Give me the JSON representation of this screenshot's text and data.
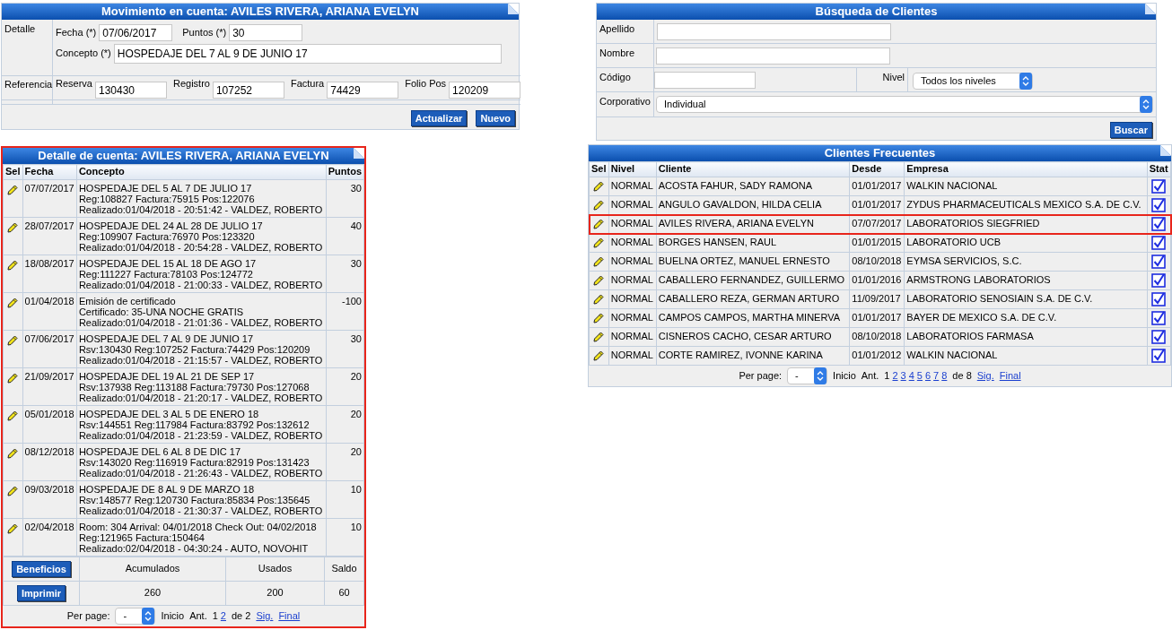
{
  "movimiento": {
    "title": "Movimiento en cuenta: AVILES RIVERA, ARIANA EVELYN",
    "detalle_label": "Detalle",
    "fecha": {
      "label": "Fecha (*)",
      "value": "07/06/2017"
    },
    "puntos": {
      "label": "Puntos (*)",
      "value": "30"
    },
    "concepto": {
      "label": "Concepto (*)",
      "value": "HOSPEDAJE DEL 7 AL 9 DE JUNIO 17"
    },
    "referencia_label": "Referencia",
    "referencias": [
      {
        "label": "Reserva",
        "value": "130430"
      },
      {
        "label": "Registro",
        "value": "107252"
      },
      {
        "label": "Factura",
        "value": "74429"
      },
      {
        "label": "Folio Pos",
        "value": "120209"
      }
    ],
    "buttons": [
      "Actualizar",
      "Nuevo"
    ]
  },
  "detalle": {
    "title": "Detalle de cuenta: AVILES RIVERA, ARIANA EVELYN",
    "highlighted": true,
    "columns": [
      "Sel",
      "Fecha",
      "Concepto",
      "Puntos"
    ],
    "rows": [
      {
        "fecha": "07/07/2017",
        "lines": [
          "HOSPEDAJE DEL 5 AL 7 DE JULIO 17",
          "Reg:108827 Factura:75915 Pos:122076",
          "Realizado:01/04/2018 - 20:51:42 - VALDEZ, ROBERTO"
        ],
        "puntos": "30"
      },
      {
        "fecha": "28/07/2017",
        "lines": [
          "HOSPEDAJE DEL 24 AL 28 DE JULIO 17",
          "Reg:109907 Factura:76970 Pos:123320",
          "Realizado:01/04/2018 - 20:54:28 - VALDEZ, ROBERTO"
        ],
        "puntos": "40"
      },
      {
        "fecha": "18/08/2017",
        "lines": [
          "HOSPEDAJE DEL 15 AL 18 DE AGO 17",
          "Reg:111227 Factura:78103 Pos:124772",
          "Realizado:01/04/2018 - 21:00:33 - VALDEZ, ROBERTO"
        ],
        "puntos": "30"
      },
      {
        "fecha": "01/04/2018",
        "lines": [
          "Emisión de certificado",
          "Certificado: 35-UNA NOCHE GRATIS",
          "Realizado:01/04/2018 - 21:01:36 - VALDEZ, ROBERTO"
        ],
        "puntos": "-100"
      },
      {
        "fecha": "07/06/2017",
        "lines": [
          "HOSPEDAJE DEL 7 AL 9 DE JUNIO 17",
          "Rsv:130430 Reg:107252 Factura:74429 Pos:120209",
          "Realizado:01/04/2018 - 21:15:57 - VALDEZ, ROBERTO"
        ],
        "puntos": "30"
      },
      {
        "fecha": "21/09/2017",
        "lines": [
          "HOSPEDAJE DEL 19 AL 21 DE SEP 17",
          "Rsv:137938 Reg:113188 Factura:79730 Pos:127068",
          "Realizado:01/04/2018 - 21:20:17 - VALDEZ, ROBERTO"
        ],
        "puntos": "20"
      },
      {
        "fecha": "05/01/2018",
        "lines": [
          "HOSPEDAJE DEL 3 AL 5 DE ENERO 18",
          "Rsv:144551 Reg:117984 Factura:83792 Pos:132612",
          "Realizado:01/04/2018 - 21:23:59 - VALDEZ, ROBERTO"
        ],
        "puntos": "20"
      },
      {
        "fecha": "08/12/2018",
        "lines": [
          "HOSPEDAJE DEL 6 AL 8 DE DIC 17",
          "Rsv:143020 Reg:116919 Factura:82919 Pos:131423",
          "Realizado:01/04/2018 - 21:26:43 - VALDEZ, ROBERTO"
        ],
        "puntos": "20"
      },
      {
        "fecha": "09/03/2018",
        "lines": [
          "HOSPEDAJE DE 8 AL 9 DE MARZO 18",
          "Rsv:148577 Reg:120730 Factura:85834 Pos:135645",
          "Realizado:01/04/2018 - 21:30:37 - VALDEZ, ROBERTO"
        ],
        "puntos": "10"
      },
      {
        "fecha": "02/04/2018",
        "lines": [
          "Room: 304 Arrival: 04/01/2018 Check Out: 04/02/2018",
          "Reg:121965 Factura:150464",
          "Realizado:02/04/2018 - 04:30:24 - AUTO, NOVOHIT"
        ],
        "puntos": "10"
      }
    ],
    "summary": {
      "buttons": [
        "Beneficios",
        "Imprimir"
      ],
      "headers": [
        "Acumulados",
        "Usados",
        "Saldo"
      ],
      "values": [
        "260",
        "200",
        "60"
      ]
    },
    "pager": {
      "label": "Per page:",
      "select": "-",
      "first": "Inicio",
      "prev": "Ant.",
      "pages": [
        {
          "label": "1",
          "selected": true
        },
        {
          "label": "2",
          "selected": false
        }
      ],
      "total": "de 2",
      "next": "Sig.",
      "last": "Final"
    }
  },
  "busqueda": {
    "title": "Búsqueda de Clientes",
    "apellido": "Apellido",
    "nombre": "Nombre",
    "codigo": "Código",
    "nivel": {
      "label": "Nivel",
      "value": "Todos los niveles"
    },
    "corporativo": {
      "label": "Corporativo",
      "value": "Individual"
    },
    "button": "Buscar"
  },
  "clientes": {
    "title": "Clientes Frecuentes",
    "columns": [
      "Sel",
      "Nivel",
      "Cliente",
      "Desde",
      "Empresa",
      "Stat"
    ],
    "rows": [
      {
        "nivel": "NORMAL",
        "cliente": "ACOSTA FAHUR, SADY RAMONA",
        "desde": "01/01/2017",
        "empresa": "WALKIN NACIONAL",
        "checked": true,
        "highlighted": false
      },
      {
        "nivel": "NORMAL",
        "cliente": "ANGULO GAVALDON, HILDA CELIA",
        "desde": "01/01/2017",
        "empresa": "ZYDUS PHARMACEUTICALS MEXICO S.A. DE C.V.",
        "checked": true,
        "highlighted": false
      },
      {
        "nivel": "NORMAL",
        "cliente": "AVILES RIVERA, ARIANA EVELYN",
        "desde": "07/07/2017",
        "empresa": "LABORATORIOS SIEGFRIED",
        "checked": true,
        "highlighted": true
      },
      {
        "nivel": "NORMAL",
        "cliente": "BORGES HANSEN, RAUL",
        "desde": "01/01/2015",
        "empresa": "LABORATORIO UCB",
        "checked": true,
        "highlighted": false
      },
      {
        "nivel": "NORMAL",
        "cliente": "BUELNA ORTEZ, MANUEL ERNESTO",
        "desde": "08/10/2018",
        "empresa": "EYMSA SERVICIOS, S.C.",
        "checked": true,
        "highlighted": false
      },
      {
        "nivel": "NORMAL",
        "cliente": "CABALLERO FERNANDEZ, GUILLERMO",
        "desde": "01/01/2016",
        "empresa": "ARMSTRONG LABORATORIOS",
        "checked": true,
        "highlighted": false
      },
      {
        "nivel": "NORMAL",
        "cliente": "CABALLERO REZA, GERMAN ARTURO",
        "desde": "11/09/2017",
        "empresa": "LABORATORIO SENOSIAIN S.A. DE C.V.",
        "checked": true,
        "highlighted": false
      },
      {
        "nivel": "NORMAL",
        "cliente": "CAMPOS CAMPOS, MARTHA MINERVA",
        "desde": "01/01/2017",
        "empresa": "BAYER DE MEXICO S.A. DE C.V.",
        "checked": true,
        "highlighted": false
      },
      {
        "nivel": "NORMAL",
        "cliente": "CISNEROS CACHO, CESAR ARTURO",
        "desde": "08/10/2018",
        "empresa": "LABORATORIOS FARMASA",
        "checked": true,
        "highlighted": false
      },
      {
        "nivel": "NORMAL",
        "cliente": "CORTE RAMIREZ, IVONNE KARINA",
        "desde": "01/01/2012",
        "empresa": "WALKIN NACIONAL",
        "checked": true,
        "highlighted": false
      }
    ],
    "pager": {
      "label": "Per page:",
      "select": "-",
      "first": "Inicio",
      "prev": "Ant.",
      "pages": [
        {
          "label": "1",
          "selected": true
        },
        {
          "label": "2",
          "selected": false
        },
        {
          "label": "3",
          "selected": false
        },
        {
          "label": "4",
          "selected": false
        },
        {
          "label": "5",
          "selected": false
        },
        {
          "label": "6",
          "selected": false
        },
        {
          "label": "7",
          "selected": false
        },
        {
          "label": "8",
          "selected": false
        }
      ],
      "total": "de 8",
      "next": "Sig.",
      "last": "Final"
    }
  }
}
